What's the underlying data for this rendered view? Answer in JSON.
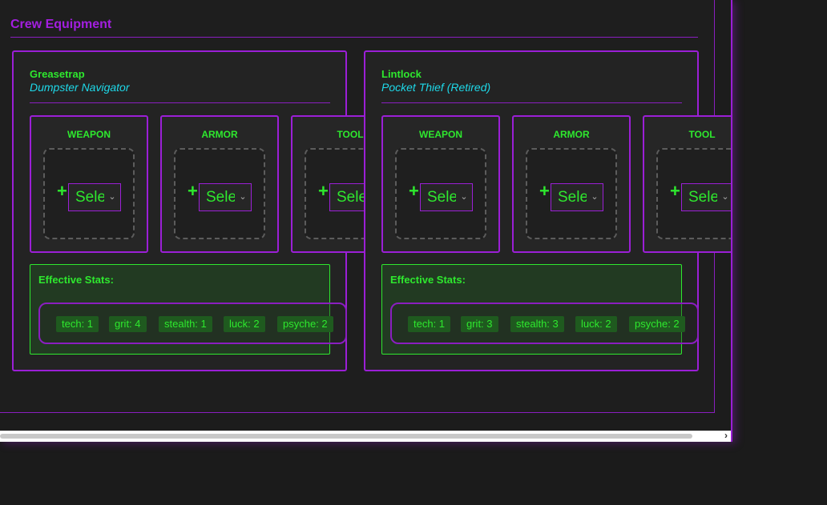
{
  "section": {
    "title": "Crew Equipment"
  },
  "crew": [
    {
      "name": "Greasetrap",
      "role": "Dumpster Navigator",
      "slots": [
        {
          "label": "WEAPON",
          "select_value": "Select"
        },
        {
          "label": "ARMOR",
          "select_value": "Select"
        },
        {
          "label": "TOOL",
          "select_value": "Select"
        }
      ],
      "stats_title": "Effective Stats:",
      "stats": [
        "tech: 1",
        "grit: 4",
        "stealth: 1",
        "luck: 2",
        "psyche: 2"
      ]
    },
    {
      "name": "Lintlock",
      "role": "Pocket Thief (Retired)",
      "slots": [
        {
          "label": "WEAPON",
          "select_value": "Select"
        },
        {
          "label": "ARMOR",
          "select_value": "Select"
        },
        {
          "label": "TOOL",
          "select_value": "Select"
        }
      ],
      "stats_title": "Effective Stats:",
      "stats": [
        "tech: 1",
        "grit: 3",
        "stealth: 3",
        "luck: 2",
        "psyche: 2"
      ]
    }
  ],
  "icons": {
    "add": "plus-icon",
    "dropdown": "chevron-down-icon",
    "scroll_right": "chevron-right-icon"
  },
  "colors": {
    "accent": "#9b1fd6",
    "text_green": "#2ee82e",
    "text_cyan": "#1ed8e8",
    "background": "#1b1b1b"
  }
}
